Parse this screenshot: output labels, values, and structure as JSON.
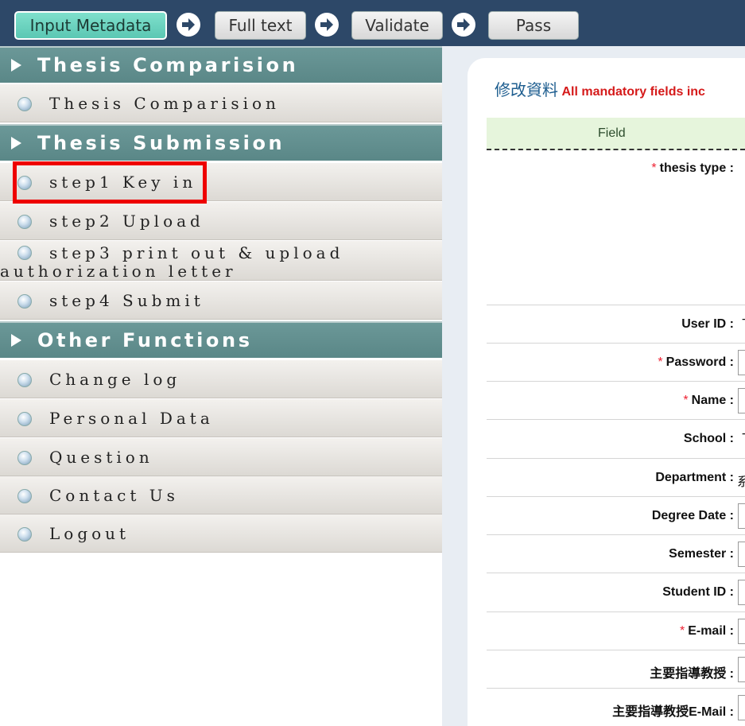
{
  "workflow": {
    "steps": [
      {
        "label": "Input Metadata",
        "active": true
      },
      {
        "label": "Full text",
        "active": false
      },
      {
        "label": "Validate",
        "active": false
      },
      {
        "label": "Pass",
        "active": false
      }
    ]
  },
  "sidebar": {
    "sections": [
      {
        "title": "Thesis Comparision",
        "items": [
          "Thesis Comparision"
        ]
      },
      {
        "title": "Thesis Submission",
        "items": [
          "step1 Key in",
          "step2 Upload",
          "step3 print out & upload",
          "step4 Submit"
        ],
        "step3_line2": "authorization letter"
      },
      {
        "title": "Other Functions",
        "items": [
          "Change log",
          "Personal Data",
          "Question",
          "Contact Us",
          "Logout"
        ]
      }
    ]
  },
  "form": {
    "title_zh": "修改資料",
    "title_note": "All mandatory fields inc",
    "column_header": "Field",
    "fields": [
      {
        "label": "thesis type :",
        "required": true
      },
      {
        "label": "User ID :",
        "required": false,
        "value": "T"
      },
      {
        "label": "Password :",
        "required": true
      },
      {
        "label": "Name :",
        "required": true
      },
      {
        "label": "School :",
        "required": false,
        "value": "T"
      },
      {
        "label": "Department :",
        "required": false,
        "value": "系"
      },
      {
        "label": "Degree Date :",
        "required": false
      },
      {
        "label": "Semester :",
        "required": false
      },
      {
        "label": "Student ID :",
        "required": false
      },
      {
        "label": "E-mail :",
        "required": true
      },
      {
        "label": "主要指導教授 :",
        "required": false
      },
      {
        "label": "主要指導教授E-Mail :",
        "required": false
      }
    ]
  },
  "colors": {
    "topbar": "#2d4868",
    "section_header": "#5a8787",
    "highlight": "#ee0000",
    "required_star": "#e22233"
  }
}
